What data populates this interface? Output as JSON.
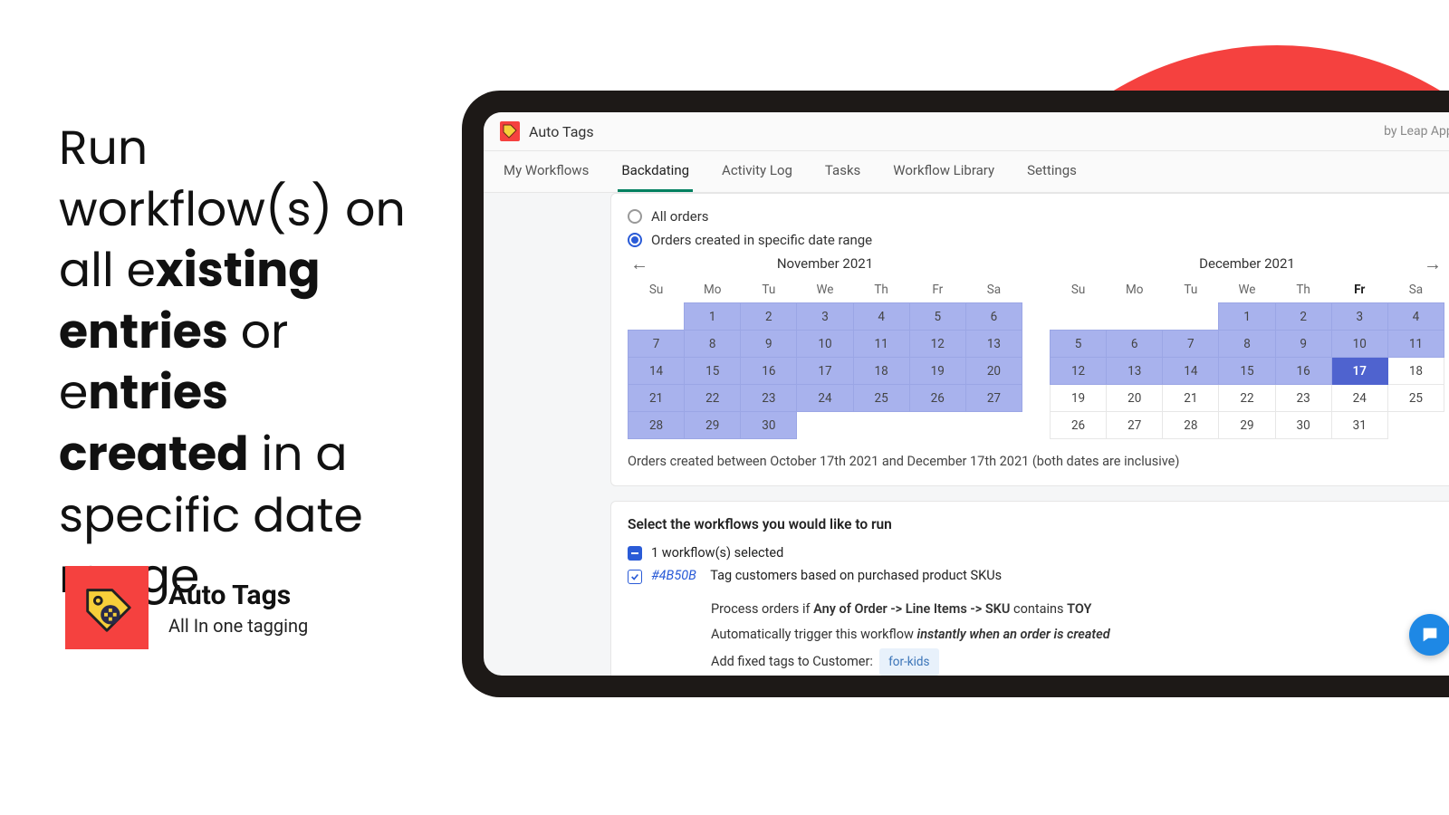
{
  "hero": {
    "pre1": "Run workflow(s) on all e",
    "b1": "xisting entries",
    "mid": " or e",
    "b2": "ntries created",
    "post": " in a specific date range"
  },
  "badge": {
    "title": "Auto Tags",
    "subtitle": "All In one tagging"
  },
  "app": {
    "title": "Auto Tags",
    "byline": "by Leap Apps",
    "tabs": [
      "My Workflows",
      "Backdating",
      "Activity Log",
      "Tasks",
      "Workflow Library",
      "Settings"
    ],
    "active_tab_index": 1
  },
  "scope": {
    "opt_all": "All orders",
    "opt_range": "Orders created in specific date range"
  },
  "calendar": {
    "left_month": "November 2021",
    "right_month": "December 2021",
    "dow": [
      "Su",
      "Mo",
      "Tu",
      "We",
      "Th",
      "Fr",
      "Sa"
    ],
    "range_text": "Orders created between October 17th 2021 and December 17th 2021 (both dates are inclusive)",
    "nov": {
      "rows": [
        [
          null,
          1,
          2,
          3,
          4,
          5,
          6
        ],
        [
          7,
          8,
          9,
          10,
          11,
          12,
          13
        ],
        [
          14,
          15,
          16,
          17,
          18,
          19,
          20
        ],
        [
          21,
          22,
          23,
          24,
          25,
          26,
          27
        ],
        [
          28,
          29,
          30,
          null,
          null,
          null,
          null
        ]
      ]
    },
    "dec": {
      "selected_through": 17,
      "today_col": 5,
      "rows": [
        [
          null,
          null,
          null,
          1,
          2,
          3,
          4
        ],
        [
          5,
          6,
          7,
          8,
          9,
          10,
          11
        ],
        [
          12,
          13,
          14,
          15,
          16,
          17,
          18
        ],
        [
          19,
          20,
          21,
          22,
          23,
          24,
          25
        ],
        [
          26,
          27,
          28,
          29,
          30,
          31,
          null
        ]
      ]
    }
  },
  "workflows": {
    "heading": "Select the workflows you would like to run",
    "selected_text": "1 workflow(s) selected",
    "item": {
      "id": "#4B50B",
      "title": "Tag customers based on purchased product SKUs",
      "line1_pre": "Process orders if ",
      "line1_bold": "Any of Order -> Line Items -> SKU",
      "line1_mid": " contains ",
      "line1_bold2": "TOY",
      "line2_pre": "Automatically trigger this workflow ",
      "line2_ital": "instantly when an order is created",
      "line3_pre": "Add fixed tags to Customer:",
      "tag": "for-kids"
    }
  }
}
